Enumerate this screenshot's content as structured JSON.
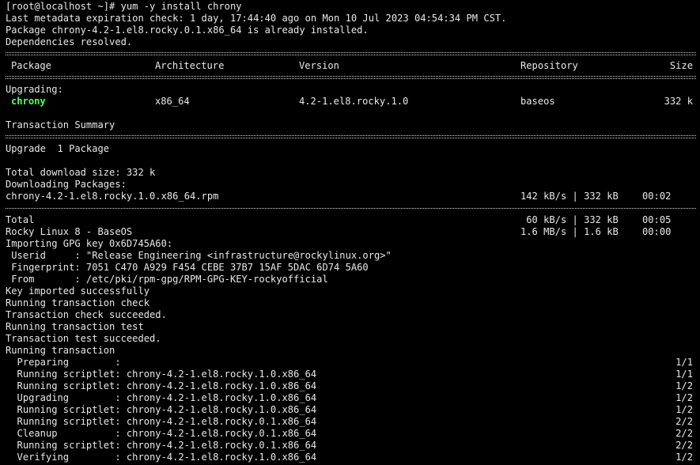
{
  "terminal": {
    "prompt_command": "[root@localhost ~]# yum -y install chrony",
    "metadata_line": "Last metadata expiration check: 1 day, 17:44:40 ago on Mon 10 Jul 2023 04:54:34 PM CST.",
    "installed_line": "Package chrony-4.2-1.el8.rocky.0.1.x86_64 is already installed.",
    "deps_line": "Dependencies resolved.",
    "table": {
      "headers": [
        "Package",
        "Architecture",
        "Version",
        "Repository",
        "Size"
      ],
      "section": "Upgrading:",
      "row": {
        "package": "chrony",
        "arch": "x86_64",
        "version": "4.2-1.el8.rocky.1.0",
        "repo": "baseos",
        "size": "332 k"
      }
    },
    "summary_title": "Transaction Summary",
    "summary_line": "Upgrade  1 Package",
    "total_download": "Total download size: 332 k",
    "downloading": "Downloading Packages:",
    "download_file": {
      "name": "chrony-4.2-1.el8.rocky.1.0.x86_64.rpm",
      "speed": "142 kB/s | 332 kB",
      "time": "00:02"
    },
    "total": {
      "label": "Total",
      "speed": " 60 kB/s | 332 kB",
      "time": "00:05"
    },
    "repo_line": {
      "label": "Rocky Linux 8 - BaseOS",
      "speed": "1.6 MB/s | 1.6 kB",
      "time": "00:00"
    },
    "gpg_lines": [
      "Importing GPG key 0x6D745A60:",
      " Userid     : \"Release Engineering <infrastructure@rockylinux.org>\"",
      " Fingerprint: 7051 C470 A929 F454 CEBE 37B7 15AF 5DAC 6D74 5A60",
      " From       : /etc/pki/rpm-gpg/RPM-GPG-KEY-rockyofficial",
      "Key imported successfully",
      "Running transaction check",
      "Transaction check succeeded.",
      "Running transaction test",
      "Transaction test succeeded.",
      "Running transaction"
    ],
    "steps": [
      {
        "text": "  Preparing        :",
        "count": "1/1"
      },
      {
        "text": "  Running scriptlet: chrony-4.2-1.el8.rocky.1.0.x86_64",
        "count": "1/1"
      },
      {
        "text": "  Running scriptlet: chrony-4.2-1.el8.rocky.1.0.x86_64",
        "count": "1/2"
      },
      {
        "text": "  Upgrading        : chrony-4.2-1.el8.rocky.1.0.x86_64",
        "count": "1/2"
      },
      {
        "text": "  Running scriptlet: chrony-4.2-1.el8.rocky.1.0.x86_64",
        "count": "1/2"
      },
      {
        "text": "  Running scriptlet: chrony-4.2-1.el8.rocky.0.1.x86_64",
        "count": "2/2"
      },
      {
        "text": "  Cleanup          : chrony-4.2-1.el8.rocky.0.1.x86_64",
        "count": "2/2"
      },
      {
        "text": "  Running scriptlet: chrony-4.2-1.el8.rocky.0.1.x86_64",
        "count": "2/2"
      },
      {
        "text": "  Verifying        : chrony-4.2-1.el8.rocky.1.0.x86_64",
        "count": "1/2"
      }
    ],
    "colors": {
      "background": "#000000",
      "text": "#e8e8e8",
      "highlight": "#54ff54"
    }
  }
}
